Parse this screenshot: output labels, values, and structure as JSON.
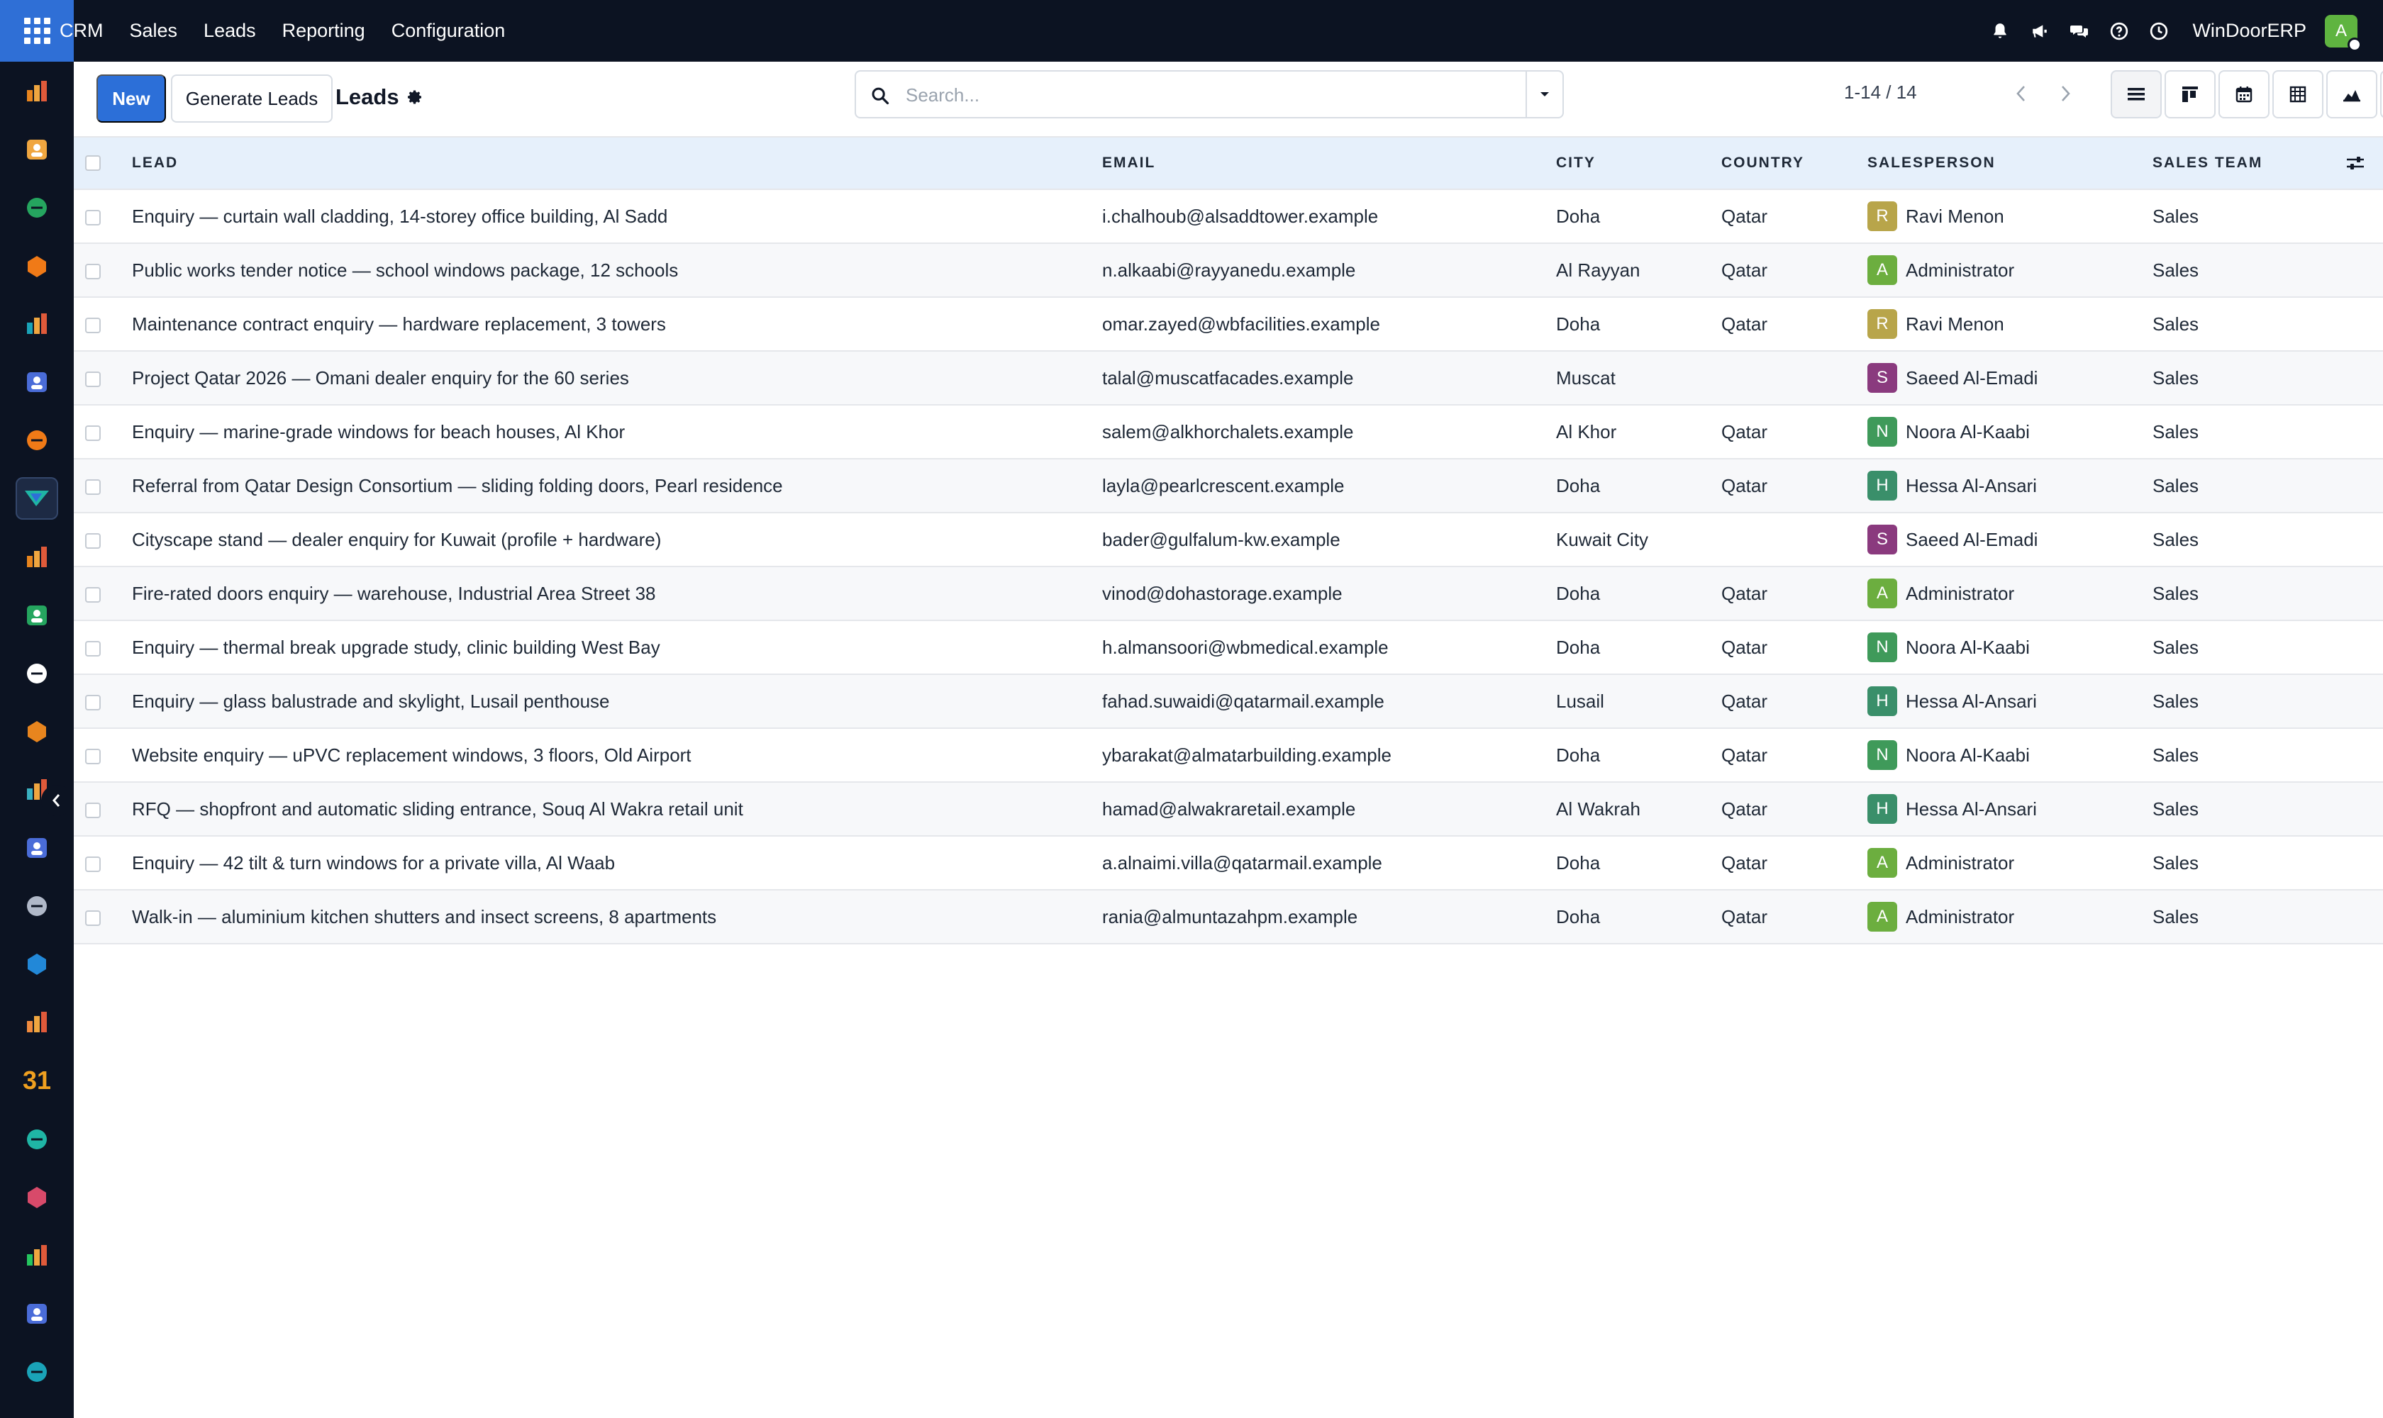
{
  "topbar": {
    "menu": [
      "CRM",
      "Sales",
      "Leads",
      "Reporting",
      "Configuration"
    ],
    "icons": [
      "bell-icon",
      "megaphone-icon",
      "chat-icon",
      "help-icon",
      "clock-icon"
    ],
    "company": "WinDoorERP",
    "user_initial": "A"
  },
  "sidebar": {
    "apps": [
      "reporting-app-icon",
      "photo-app-icon",
      "contacts-app-icon",
      "discuss-app-icon",
      "website-app-icon",
      "email-marketing-app-icon",
      "live-chat-app-icon",
      "crm-app-icon",
      "sales-app-icon",
      "employees-app-icon",
      "inventory-app-icon",
      "marketing-app-icon",
      "project-app-icon",
      "knowledge-app-icon",
      "3d-app-icon",
      "invoicing-app-icon",
      "team-app-icon",
      "calendar-app-icon",
      "sign-app-icon",
      "dashboard-app-icon",
      "whatsapp-app-icon",
      "timesheet-app-icon",
      "surveys-app-icon"
    ],
    "calendar_day": "31"
  },
  "control": {
    "new_label": "New",
    "generate_label": "Generate Leads",
    "breadcrumb": "Leads",
    "search_placeholder": "Search...",
    "pager": "1-14 / 14",
    "views": [
      "list-view-icon",
      "kanban-view-icon",
      "calendar-view-icon",
      "pivot-view-icon",
      "graph-view-icon",
      "activity-view-icon"
    ]
  },
  "table": {
    "columns": [
      "LEAD",
      "EMAIL",
      "CITY",
      "COUNTRY",
      "SALESPERSON",
      "SALES TEAM"
    ],
    "salesperson_colors": {
      "R": "#b8a54a",
      "A": "#6cae3f",
      "S": "#8a3a7e",
      "N": "#3f9a5a",
      "H": "#3a8f6a"
    },
    "rows": [
      {
        "lead": "Enquiry — curtain wall cladding, 14-storey office building, Al Sadd",
        "email": "i.chalhoub@alsaddtower.example",
        "city": "Doha",
        "country": "Qatar",
        "initial": "R",
        "salesperson": "Ravi Menon",
        "team": "Sales"
      },
      {
        "lead": "Public works tender notice — school windows package, 12 schools",
        "email": "n.alkaabi@rayyanedu.example",
        "city": "Al Rayyan",
        "country": "Qatar",
        "initial": "A",
        "salesperson": "Administrator",
        "team": "Sales"
      },
      {
        "lead": "Maintenance contract enquiry — hardware replacement, 3 towers",
        "email": "omar.zayed@wbfacilities.example",
        "city": "Doha",
        "country": "Qatar",
        "initial": "R",
        "salesperson": "Ravi Menon",
        "team": "Sales"
      },
      {
        "lead": "Project Qatar 2026 — Omani dealer enquiry for the 60 series",
        "email": "talal@muscatfacades.example",
        "city": "Muscat",
        "country": "",
        "initial": "S",
        "salesperson": "Saeed Al-Emadi",
        "team": "Sales"
      },
      {
        "lead": "Enquiry — marine-grade windows for beach houses, Al Khor",
        "email": "salem@alkhorchalets.example",
        "city": "Al Khor",
        "country": "Qatar",
        "initial": "N",
        "salesperson": "Noora Al-Kaabi",
        "team": "Sales"
      },
      {
        "lead": "Referral from Qatar Design Consortium — sliding folding doors, Pearl residence",
        "email": "layla@pearlcrescent.example",
        "city": "Doha",
        "country": "Qatar",
        "initial": "H",
        "salesperson": "Hessa Al-Ansari",
        "team": "Sales"
      },
      {
        "lead": "Cityscape stand — dealer enquiry for Kuwait (profile + hardware)",
        "email": "bader@gulfalum-kw.example",
        "city": "Kuwait City",
        "country": "",
        "initial": "S",
        "salesperson": "Saeed Al-Emadi",
        "team": "Sales"
      },
      {
        "lead": "Fire-rated doors enquiry — warehouse, Industrial Area Street 38",
        "email": "vinod@dohastorage.example",
        "city": "Doha",
        "country": "Qatar",
        "initial": "A",
        "salesperson": "Administrator",
        "team": "Sales"
      },
      {
        "lead": "Enquiry — thermal break upgrade study, clinic building West Bay",
        "email": "h.almansoori@wbmedical.example",
        "city": "Doha",
        "country": "Qatar",
        "initial": "N",
        "salesperson": "Noora Al-Kaabi",
        "team": "Sales"
      },
      {
        "lead": "Enquiry — glass balustrade and skylight, Lusail penthouse",
        "email": "fahad.suwaidi@qatarmail.example",
        "city": "Lusail",
        "country": "Qatar",
        "initial": "H",
        "salesperson": "Hessa Al-Ansari",
        "team": "Sales"
      },
      {
        "lead": "Website enquiry — uPVC replacement windows, 3 floors, Old Airport",
        "email": "ybarakat@almatarbuilding.example",
        "city": "Doha",
        "country": "Qatar",
        "initial": "N",
        "salesperson": "Noora Al-Kaabi",
        "team": "Sales"
      },
      {
        "lead": "RFQ — shopfront and automatic sliding entrance, Souq Al Wakra retail unit",
        "email": "hamad@alwakraretail.example",
        "city": "Al Wakrah",
        "country": "Qatar",
        "initial": "H",
        "salesperson": "Hessa Al-Ansari",
        "team": "Sales"
      },
      {
        "lead": "Enquiry — 42 tilt & turn windows for a private villa, Al Waab",
        "email": "a.alnaimi.villa@qatarmail.example",
        "city": "Doha",
        "country": "Qatar",
        "initial": "A",
        "salesperson": "Administrator",
        "team": "Sales"
      },
      {
        "lead": "Walk-in — aluminium kitchen shutters and insect screens, 8 apartments",
        "email": "rania@almuntazahpm.example",
        "city": "Doha",
        "country": "Qatar",
        "initial": "A",
        "salesperson": "Administrator",
        "team": "Sales"
      }
    ]
  }
}
